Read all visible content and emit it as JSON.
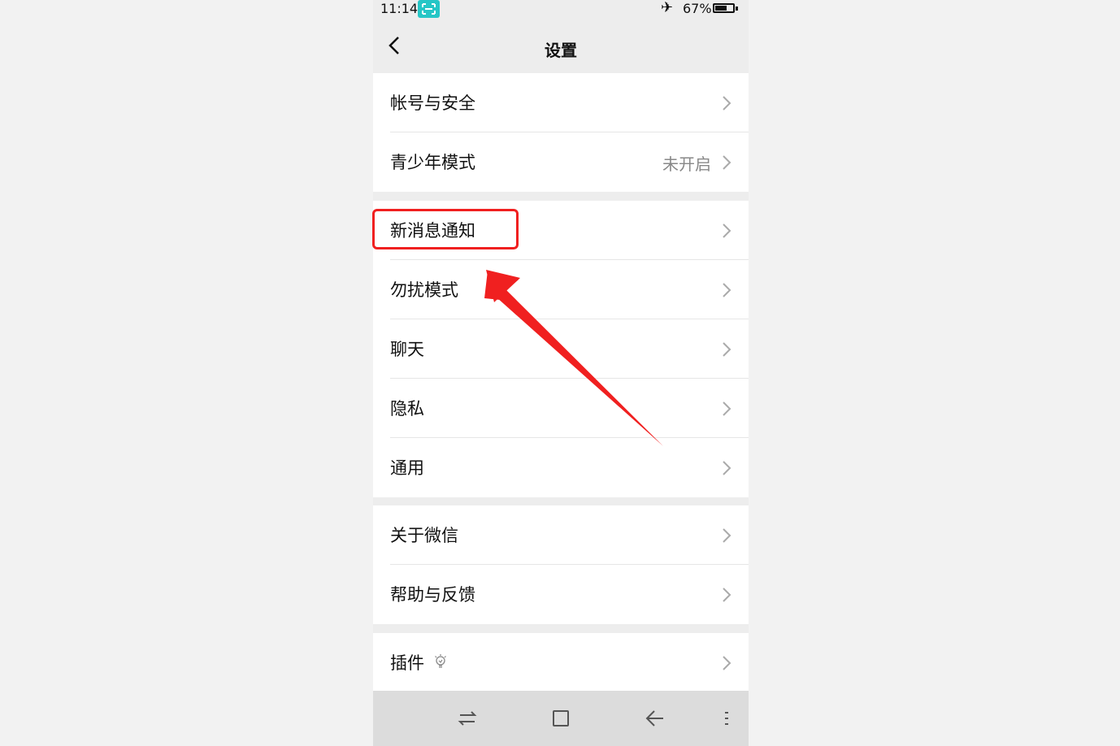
{
  "status_bar": {
    "time": "11:14",
    "battery": "67%",
    "battery_level": 0.67
  },
  "header": {
    "title": "设置"
  },
  "groups": [
    {
      "items": [
        {
          "label": "帐号与安全"
        },
        {
          "label": "青少年模式",
          "value": "未开启"
        }
      ]
    },
    {
      "items": [
        {
          "label": "新消息通知"
        },
        {
          "label": "勿扰模式"
        },
        {
          "label": "聊天"
        },
        {
          "label": "隐私"
        },
        {
          "label": "通用"
        }
      ]
    },
    {
      "items": [
        {
          "label": "关于微信"
        },
        {
          "label": "帮助与反馈"
        }
      ]
    },
    {
      "items": [
        {
          "label": "插件"
        }
      ]
    }
  ],
  "colors": {
    "annotation": "#f02020",
    "scan_badge": "#26c6c6"
  }
}
